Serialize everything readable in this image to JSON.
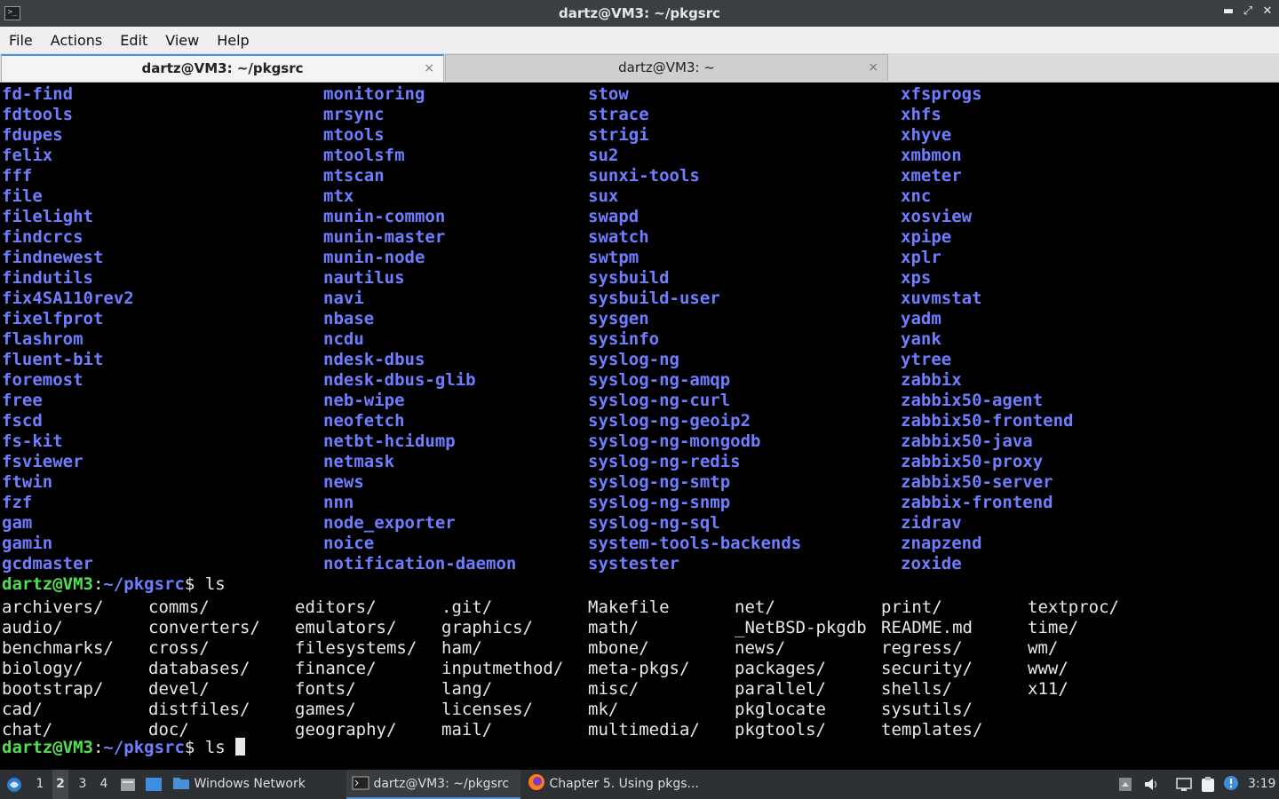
{
  "window": {
    "title": "dartz@VM3: ~/pkgsrc",
    "controls": {
      "minimize": "▬",
      "maximize": "⤢",
      "close": "✕"
    }
  },
  "menu": [
    "File",
    "Actions",
    "Edit",
    "View",
    "Help"
  ],
  "tabs": [
    {
      "label": "dartz@VM3: ~/pkgsrc",
      "close": "×"
    },
    {
      "label": "dartz@VM3: ~",
      "close": "×"
    }
  ],
  "terminal": {
    "colors": {
      "package": "#6f7dff",
      "prompt_user": "#4fe04f",
      "text": "#e8e8e8",
      "background": "#000000"
    },
    "package_columns": [
      [
        "fd-find",
        "fdtools",
        "fdupes",
        "felix",
        "fff",
        "file",
        "filelight",
        "findcrcs",
        "findnewest",
        "findutils",
        "fix4SA110rev2",
        "fixelfprot",
        "flashrom",
        "fluent-bit",
        "foremost",
        "free",
        "fscd",
        "fs-kit",
        "fsviewer",
        "ftwin",
        "fzf",
        "gam",
        "gamin",
        "gcdmaster"
      ],
      [
        "monitoring",
        "mrsync",
        "mtools",
        "mtoolsfm",
        "mtscan",
        "mtx",
        "munin-common",
        "munin-master",
        "munin-node",
        "nautilus",
        "navi",
        "nbase",
        "ncdu",
        "ndesk-dbus",
        "ndesk-dbus-glib",
        "neb-wipe",
        "neofetch",
        "netbt-hcidump",
        "netmask",
        "news",
        "nnn",
        "node_exporter",
        "noice",
        "notification-daemon"
      ],
      [
        "stow",
        "strace",
        "strigi",
        "su2",
        "sunxi-tools",
        "sux",
        "swapd",
        "swatch",
        "swtpm",
        "sysbuild",
        "sysbuild-user",
        "sysgen",
        "sysinfo",
        "syslog-ng",
        "syslog-ng-amqp",
        "syslog-ng-curl",
        "syslog-ng-geoip2",
        "syslog-ng-mongodb",
        "syslog-ng-redis",
        "syslog-ng-smtp",
        "syslog-ng-snmp",
        "syslog-ng-sql",
        "system-tools-backends",
        "systester"
      ],
      [
        "xfsprogs",
        "xhfs",
        "xhyve",
        "xmbmon",
        "xmeter",
        "xnc",
        "xosview",
        "xpipe",
        "xplr",
        "xps",
        "xuvmstat",
        "yadm",
        "yank",
        "ytree",
        "zabbix",
        "zabbix50-agent",
        "zabbix50-frontend",
        "zabbix50-java",
        "zabbix50-proxy",
        "zabbix50-server",
        "zabbix-frontend",
        "zidrav",
        "znapzend",
        "zoxide"
      ]
    ],
    "prompt1": {
      "user": "dartz@VM3",
      "colon": ":",
      "path": "~/pkgsrc",
      "symbol": "$ ",
      "command": "ls"
    },
    "ls_columns": [
      [
        "archivers/",
        "audio/",
        "benchmarks/",
        "biology/",
        "bootstrap/",
        "cad/",
        "chat/"
      ],
      [
        "comms/",
        "converters/",
        "cross/",
        "databases/",
        "devel/",
        "distfiles/",
        "doc/"
      ],
      [
        "editors/",
        "emulators/",
        "filesystems/",
        "finance/",
        "fonts/",
        "games/",
        "geography/"
      ],
      [
        ".git/",
        "graphics/",
        "ham/",
        "inputmethod/",
        "lang/",
        "licenses/",
        "mail/"
      ],
      [
        "Makefile",
        "math/",
        "mbone/",
        "meta-pkgs/",
        "misc/",
        "mk/",
        "multimedia/"
      ],
      [
        "net/",
        "_NetBSD-pkgdb",
        "news/",
        "packages/",
        "parallel/",
        "pkglocate",
        "pkgtools/"
      ],
      [
        "print/",
        "README.md",
        "regress/",
        "security/",
        "shells/",
        "sysutils/",
        "templates/"
      ],
      [
        "textproc/",
        "time/",
        "wm/",
        "www/",
        "x11/"
      ]
    ],
    "prompt2": {
      "user": "dartz@VM3",
      "colon": ":",
      "path": "~/pkgsrc",
      "symbol": "$ ",
      "command": "ls "
    }
  },
  "taskbar": {
    "workspaces": [
      "1",
      "2",
      "3",
      "4"
    ],
    "windows": [
      {
        "label": "Windows Network",
        "icon": "folder-icon"
      },
      {
        "label": "dartz@VM3: ~/pkgsrc",
        "icon": "terminal-icon"
      },
      {
        "label": "Chapter 5. Using pkgs...",
        "icon": "firefox-icon"
      }
    ],
    "clock": "3:19"
  }
}
